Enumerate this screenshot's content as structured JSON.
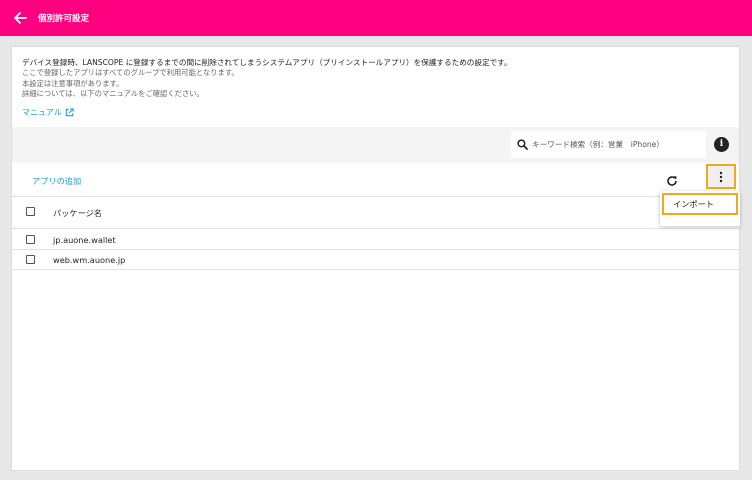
{
  "appbar": {
    "title": "個別許可設定",
    "color": "#ff0080"
  },
  "description": {
    "main": "デバイス登録時、LANSCOPE に登録するまでの間に削除されてしまうシステムアプリ（プリインストールアプリ）を保護するための設定です。",
    "lines": [
      "ここで登録したアプリはすべてのグループで利用可能となります。",
      "本設定は注意事項があります。",
      "詳細については、以下のマニュアルをご確認ください。"
    ],
    "manual_link": "マニュアル"
  },
  "search": {
    "placeholder": "キーワード検索（例：営業　iPhone）"
  },
  "actions": {
    "add_app": "アプリの追加"
  },
  "table": {
    "column_header": "パッケージ名",
    "rows": [
      "jp.auone.wallet",
      "web.wm.auone.jp"
    ]
  },
  "menu": {
    "items": [
      "インポート"
    ]
  },
  "icons": {
    "back": "arrow-left-icon",
    "search": "search-icon",
    "info": "info-icon",
    "refresh": "refresh-icon",
    "more": "more-vert-icon",
    "external": "external-link-icon"
  },
  "colors": {
    "accent": "#ff0080",
    "link": "#1a9fd6",
    "highlight": "#f0a820"
  }
}
